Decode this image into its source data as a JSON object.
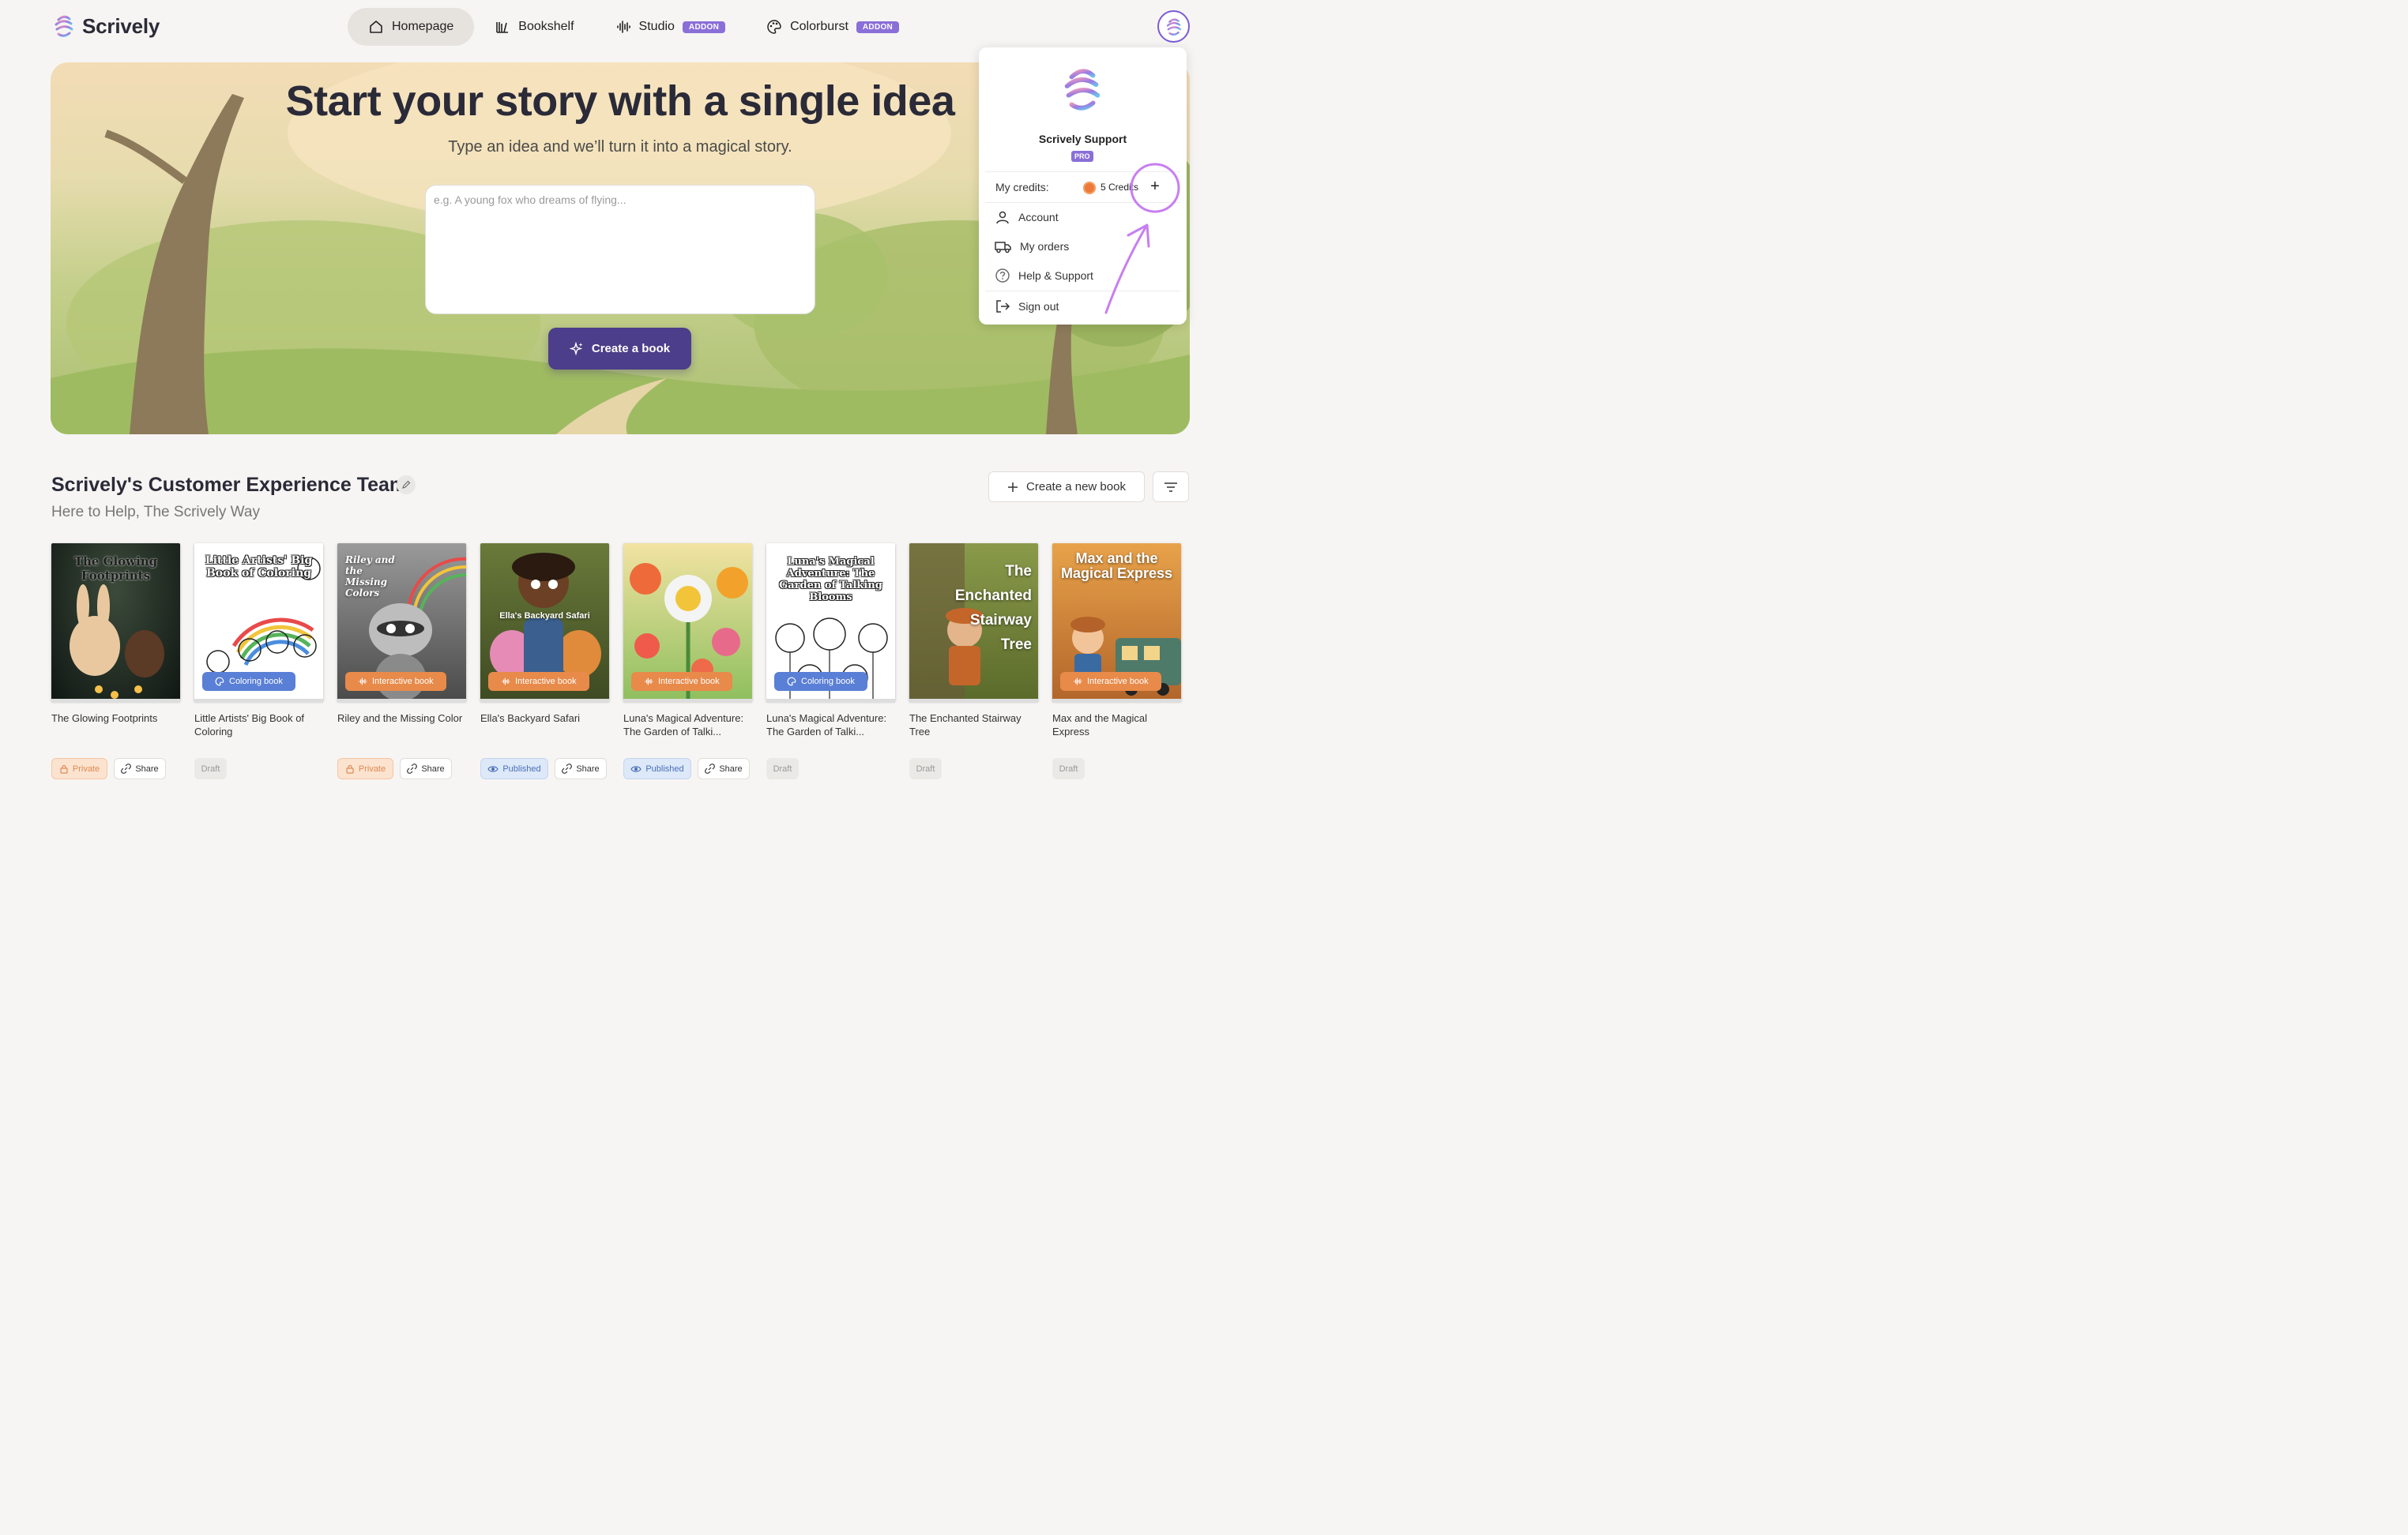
{
  "app": {
    "name": "Scrively"
  },
  "nav": {
    "items": [
      {
        "label": "Homepage",
        "icon": "home-icon"
      },
      {
        "label": "Bookshelf",
        "icon": "bookshelf-icon"
      },
      {
        "label": "Studio",
        "icon": "audio-wave-icon",
        "badge": "ADDON"
      },
      {
        "label": "Colorburst",
        "icon": "palette-icon",
        "badge": "ADDON"
      }
    ]
  },
  "hero": {
    "title": "Start your story with a single idea",
    "subtitle": "Type an idea and we’ll turn it into a magical story.",
    "placeholder": "e.g. A young fox who dreams of flying...",
    "value": "",
    "button": "Create a book"
  },
  "menu": {
    "name": "Scrively Support",
    "plan": "PRO",
    "credits_label": "My credits:",
    "credits_value": "5 Credits",
    "items": [
      {
        "label": "Account",
        "icon": "user-icon"
      },
      {
        "label": "My orders",
        "icon": "truck-icon"
      },
      {
        "label": "Help & Support",
        "icon": "help-icon"
      },
      {
        "label": "Sign out",
        "icon": "sign-out-icon"
      }
    ]
  },
  "section": {
    "title": "Scrively's Customer Experience Team",
    "subtitle": "Here to Help, The Scrively Way",
    "new_book": "Create a new book"
  },
  "books": [
    {
      "title": "The Glowing Footprints",
      "cover_text": "The Glowing Footprints",
      "badge": "",
      "status": "Private",
      "share": "Share"
    },
    {
      "title": "Little Artists' Big Book of Coloring",
      "cover_text": "Little Artists' Big Book of Coloring",
      "badge": "Coloring book",
      "status": "Draft",
      "share": ""
    },
    {
      "title": "Riley and the Missing Color",
      "cover_text": "Riley and the Missing Colors",
      "badge": "Interactive book",
      "status": "Private",
      "share": "Share"
    },
    {
      "title": "Ella's Backyard Safari",
      "cover_text": "Ella's Backyard Safari",
      "badge": "Interactive book",
      "status": "Published",
      "share": "Share"
    },
    {
      "title": "Luna's Magical Adventure: The Garden of Talki...",
      "cover_text": "",
      "badge": "Interactive book",
      "status": "Published",
      "share": "Share"
    },
    {
      "title": "Luna's Magical Adventure: The Garden of Talki...",
      "cover_text": "Luna's Magical Adventure: The Garden of Talking Blooms",
      "badge": "Coloring book",
      "status": "Draft",
      "share": ""
    },
    {
      "title": "The Enchanted Stairway Tree",
      "cover_text": "The Enchanted Stairway Tree",
      "badge": "",
      "status": "Draft",
      "share": ""
    },
    {
      "title": "Max and the Magical Express",
      "cover_text": "Max and the Magical Express",
      "badge": "Interactive book",
      "status": "Draft",
      "share": ""
    }
  ],
  "colors": {
    "accent": "#8a6fd8",
    "button": "#4c3e8a",
    "private": "#e08a52",
    "published": "#4a70b8"
  }
}
